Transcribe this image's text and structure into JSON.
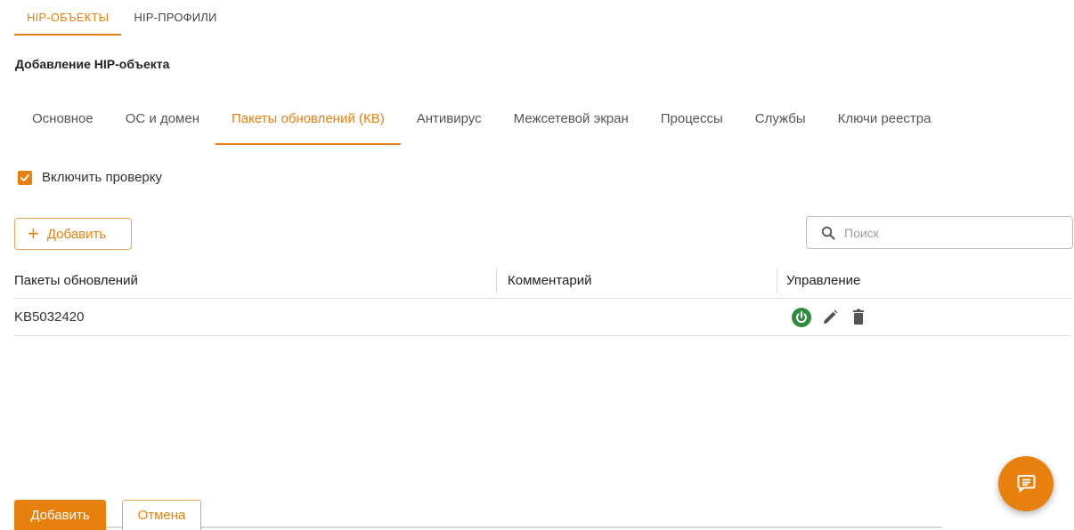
{
  "top_tabs": [
    {
      "label": "HIP-ОБЪЕКТЫ",
      "active": true
    },
    {
      "label": "HIP-ПРОФИЛИ",
      "active": false
    }
  ],
  "page_title": "Добавление HIP-объекта",
  "sub_tabs": [
    {
      "label": "Основное",
      "active": false
    },
    {
      "label": "ОС и домен",
      "active": false
    },
    {
      "label": "Пакеты обновлений (КВ)",
      "active": true
    },
    {
      "label": "Антивирус",
      "active": false
    },
    {
      "label": "Межсетевой экран",
      "active": false
    },
    {
      "label": "Процессы",
      "active": false
    },
    {
      "label": "Службы",
      "active": false
    },
    {
      "label": "Ключи реестра",
      "active": false
    }
  ],
  "enable_check": {
    "label": "Включить проверку",
    "checked": true
  },
  "toolbar": {
    "add_label": "Добавить"
  },
  "search": {
    "placeholder": "Поиск",
    "value": ""
  },
  "table": {
    "headers": [
      "Пакеты обновлений",
      "Комментарий",
      "Управление"
    ],
    "rows": [
      {
        "package": "KB5032420",
        "comment": "",
        "enabled": true
      }
    ]
  },
  "footer": {
    "submit_label": "Добавить",
    "cancel_label": "Отмена"
  },
  "icons": {
    "power": "power-icon",
    "edit": "pencil-icon",
    "delete": "trash-icon",
    "search": "search-icon",
    "chat": "chat-icon"
  },
  "colors": {
    "accent": "#e8800e",
    "enabled": "#2e8b3c",
    "icon_gray": "#555555"
  }
}
